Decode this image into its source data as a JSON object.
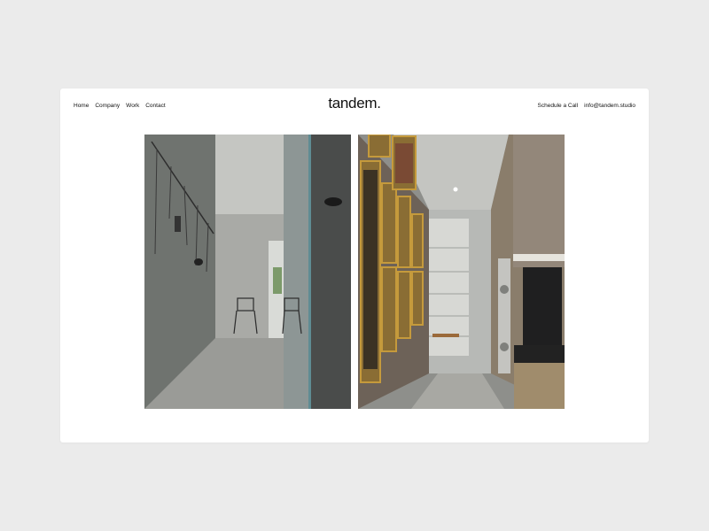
{
  "nav": {
    "items": [
      {
        "label": "Home"
      },
      {
        "label": "Company"
      },
      {
        "label": "Work"
      },
      {
        "label": "Contact"
      }
    ]
  },
  "brand": {
    "logo": "tandem."
  },
  "header_right": {
    "schedule_label": "Schedule a Call",
    "email": "info@tandem.studio"
  },
  "colors": {
    "page_background": "#ebebeb",
    "card_background": "#ffffff",
    "text": "#111111"
  }
}
